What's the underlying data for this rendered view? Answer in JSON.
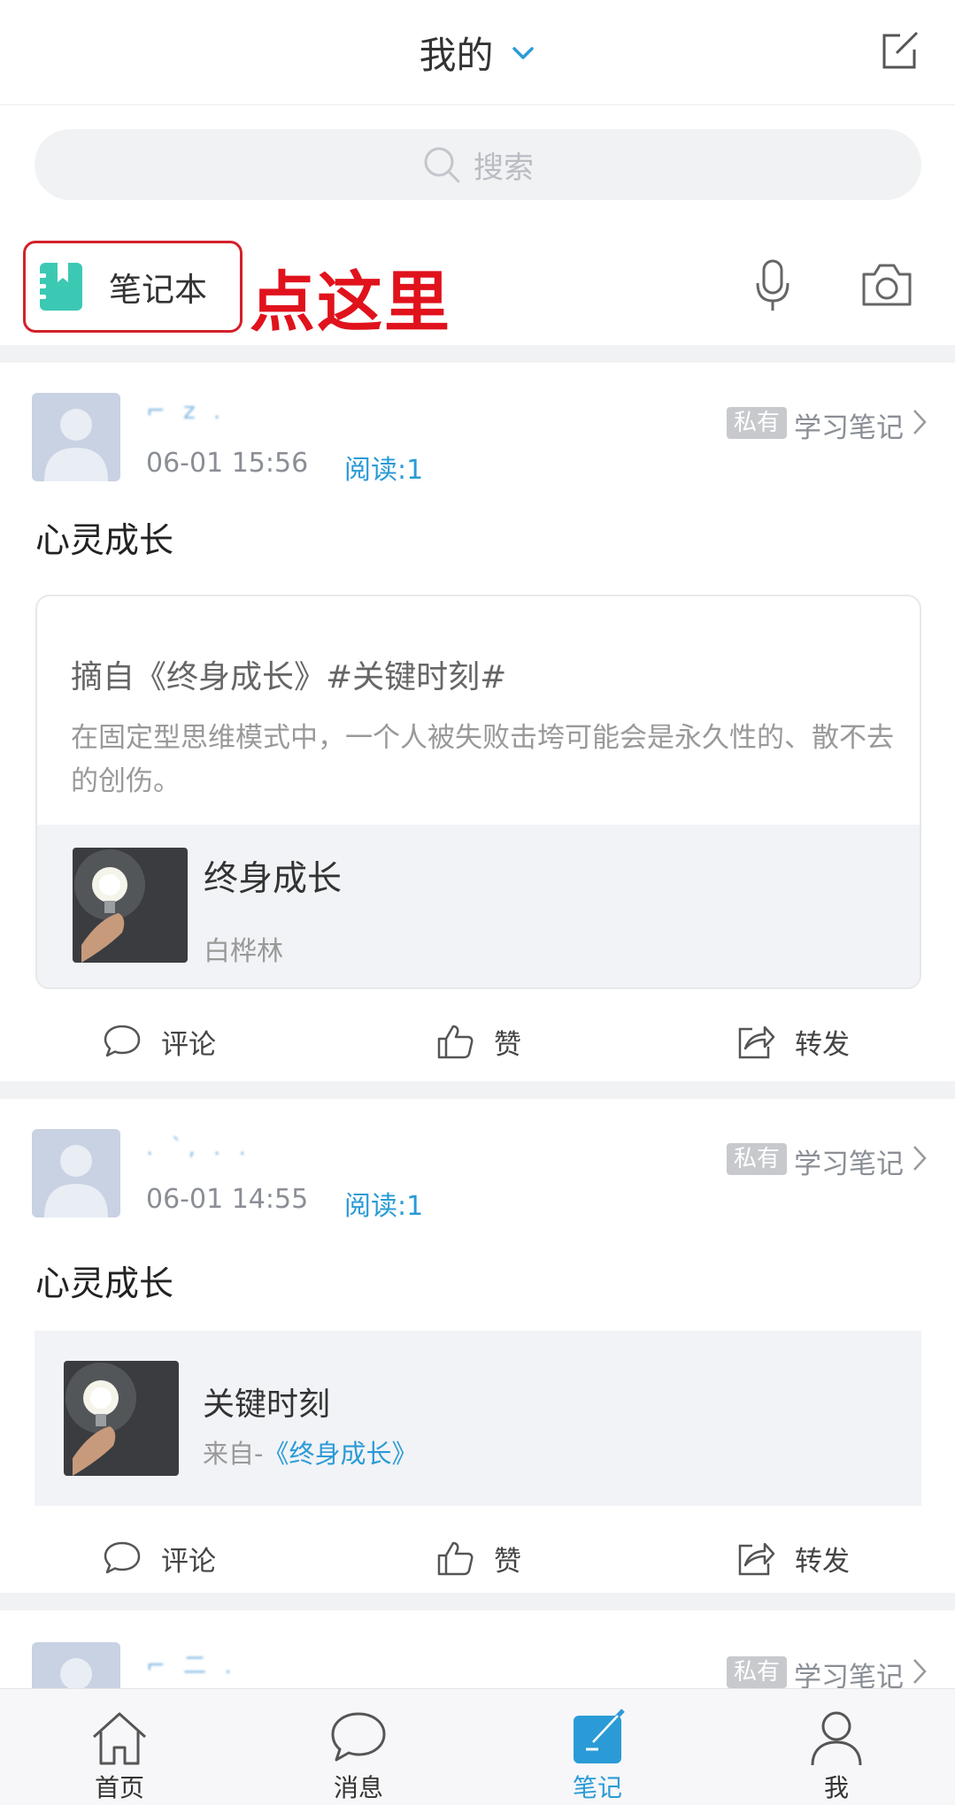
{
  "header": {
    "title": "我的"
  },
  "search": {
    "placeholder": "搜索"
  },
  "toolbar": {
    "notebook_label": "笔记本",
    "hint": "点这里"
  },
  "posts": [
    {
      "user": "⌐ z .",
      "time": "06-01 15:56",
      "reads": "阅读:1",
      "badge": "私有",
      "category": "学习笔记",
      "title": "心灵成长",
      "quote_head": "摘自《终身成长》#关键时刻#",
      "quote_text": "在固定型思维模式中，一个人被失败击垮可能会是永久性的、散不去的创伤。",
      "book_title": "终身成长",
      "book_author": "白桦林"
    },
    {
      "user": ". ˋ, . .",
      "time": "06-01 14:55",
      "reads": "阅读:1",
      "badge": "私有",
      "category": "学习笔记",
      "title": "心灵成长",
      "ref_title": "关键时刻",
      "ref_from_prefix": "来自-",
      "ref_from_book": "《终身成长》"
    },
    {
      "user": "⌐ 二 .",
      "badge": "私有",
      "category": "学习笔记"
    }
  ],
  "actions": {
    "comment": "评论",
    "like": "赞",
    "share": "转发"
  },
  "nav": [
    {
      "label": "首页",
      "icon": "home-icon"
    },
    {
      "label": "消息",
      "icon": "message-icon"
    },
    {
      "label": "笔记",
      "icon": "note-icon",
      "active": true
    },
    {
      "label": "我",
      "icon": "profile-icon"
    }
  ],
  "colors": {
    "accent": "#2a9bd6",
    "hint_red": "#e0121c",
    "notebook_teal": "#3cc9b4"
  }
}
